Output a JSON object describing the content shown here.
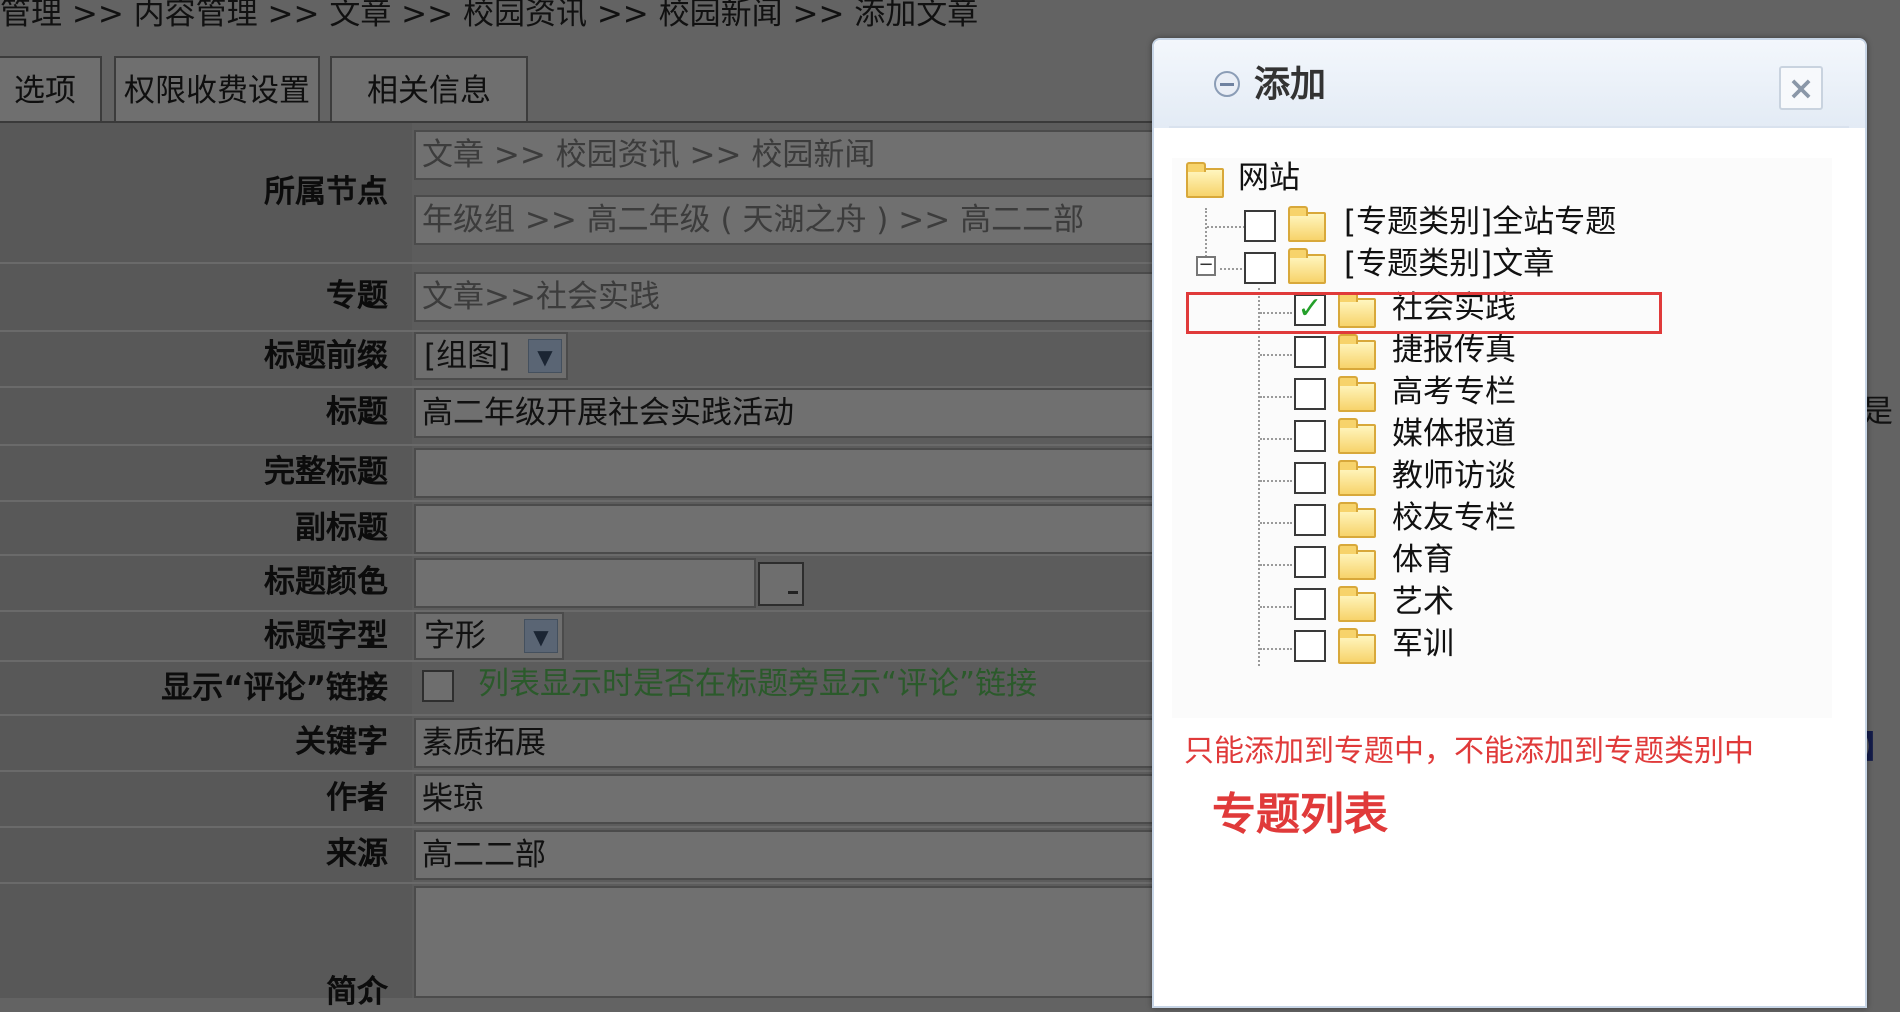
{
  "breadcrumb": "管理 >> 内容管理 >> 文章 >> 校园资讯 >> 校园新闻 >> 添加文章",
  "tabs": [
    {
      "label": "选项"
    },
    {
      "label": "权限收费设置"
    },
    {
      "label": "相关信息"
    }
  ],
  "form": {
    "node_label": "所属节点",
    "node_value_1": "文章 >> 校园资讯 >> 校园新闻",
    "node_value_2": "年级组 >> 高二年级 ( 天湖之舟 ) >> 高二二部",
    "topic_label": "专题",
    "topic_value": "文章>>社会实践",
    "prefix_label": "标题前缀",
    "prefix_value": "[组图]",
    "title_label": "标题",
    "title_value": "高二年级开展社会实践活动",
    "full_title_label": "完整标题",
    "full_title_value": "",
    "subtitle_label": "副标题",
    "subtitle_value": "",
    "title_color_label": "标题颜色",
    "title_color_value": "",
    "title_font_label": "标题字型",
    "title_font_value": "字形",
    "comment_link_label": "显示“评论”链接",
    "comment_link_hint": "列表显示时是否在标题旁显示“评论”链接",
    "keywords_label": "关键字",
    "keywords_value": "素质拓展",
    "author_label": "作者",
    "author_value": "柴琼",
    "source_label": "来源",
    "source_value": "高二二部",
    "intro_label": "简介",
    "colon": "：",
    "right_edge_text": "是",
    "right_edge_bracket": "】"
  },
  "dialog": {
    "title": "添加",
    "close": "×",
    "tree": {
      "root": "网站",
      "cat1": "[专题类别]全站专题",
      "cat2": "[专题类别]文章",
      "items": [
        "社会实践",
        "捷报传真",
        "高考专栏",
        "媒体报道",
        "教师访谈",
        "校友专栏",
        "体育",
        "艺术",
        "军训"
      ],
      "checked_index": 0
    },
    "note": "只能添加到专题中，不能添加到专题类别中",
    "note_big": "专题列表"
  },
  "colors": {
    "overlay_bg": "#636363",
    "highlight": "#e03a3a",
    "check": "#25a02b"
  }
}
